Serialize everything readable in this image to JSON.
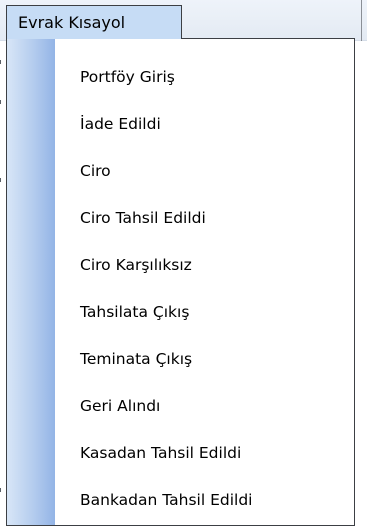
{
  "menu": {
    "title": "Evrak Kısayol",
    "items": [
      {
        "label": "Portföy Giriş"
      },
      {
        "label": "İade Edildi"
      },
      {
        "label": "Ciro"
      },
      {
        "label": "Ciro Tahsil Edildi"
      },
      {
        "label": "Ciro Karşılıksız"
      },
      {
        "label": "Tahsilata Çıkış"
      },
      {
        "label": "Teminata Çıkış"
      },
      {
        "label": "Geri Alındı"
      },
      {
        "label": "Kasadan Tahsil Edildi"
      },
      {
        "label": "Bankadan Tahsil Edildi"
      }
    ]
  }
}
